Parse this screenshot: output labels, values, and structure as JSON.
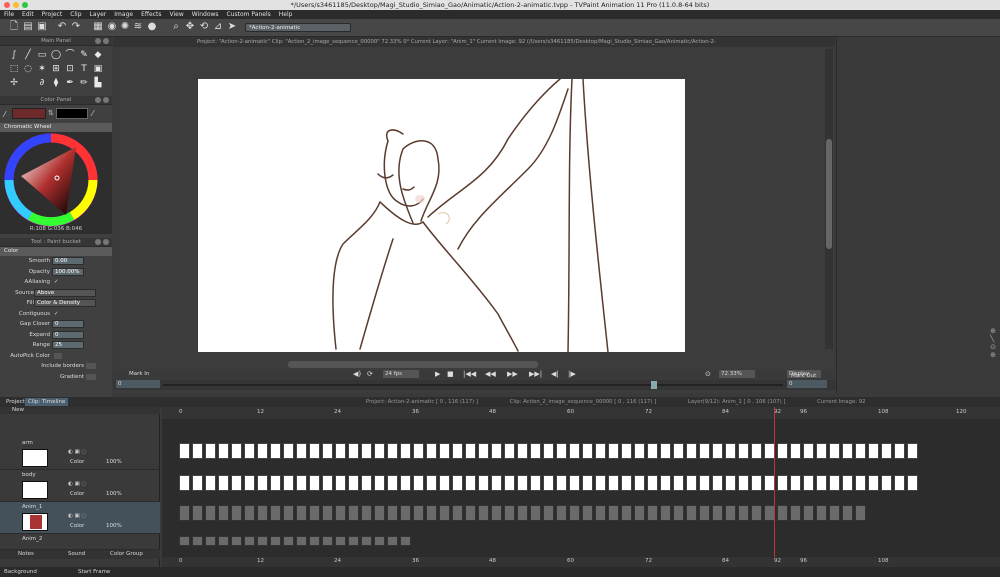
{
  "window": {
    "title": "*/Users/s3461185/Desktop/Magi_Studio_Simiao_Gao/Animatic/Action-2-animatic.tvpp - TVPaint Animation 11 Pro (11.0.8-64 bits)"
  },
  "menu": [
    "File",
    "Edit",
    "Project",
    "Clip",
    "Layer",
    "Image",
    "Effects",
    "View",
    "Windows",
    "Custom Panels",
    "Help"
  ],
  "toolbar": {
    "project_field": "*Action-2-animatic"
  },
  "main_panel": {
    "title": "Main Panel"
  },
  "color_panel": {
    "title": "Color Panel",
    "primary_color": "#6e2a2a",
    "secondary_color": "#000000",
    "wheel_label": "Chromatic Wheel",
    "rgb_readout": "R:108 G:036 B:046"
  },
  "tool_panel": {
    "title": "Tool : Paint bucket",
    "section": "Color",
    "smooth_label": "Smooth",
    "smooth_value": "0.00",
    "opacity_label": "Opacity",
    "opacity_value": "100.00%",
    "aaliasing_label": "AAliasing",
    "source_label": "Source",
    "source_value": "Above",
    "fill_label": "Fill",
    "fill_value": "Color & Density",
    "contiguous_label": "Contiguous",
    "gapcloser_label": "Gap Closer",
    "gapcloser_value": "0",
    "expand_label": "Expand",
    "expand_value": "0",
    "range_label": "Range",
    "range_value": "25",
    "autopick_label": "AutoPick Color",
    "include_borders_label": "Include borders",
    "gradient_label": "Gradient"
  },
  "viewport": {
    "header": "Project: \"Action-2-animatic\"  Clip: \"Action_2_image_sequence_00000\"  72.33%  0°  Current Layer: \"Anim_1\"  Current Image: 92 (/Users/s3461185/Desktop/Magi_Studio_Simiao_Gao/Animatic/Action-2-",
    "mark_in": "Mark In",
    "mark_out": "Mark Out",
    "fps": "24 fps",
    "zoom": "72.33%",
    "display": "Display",
    "in_value": "0",
    "out_value": "0"
  },
  "timeline": {
    "tab_project": "Project",
    "tab_clip": "Clip: Timeline",
    "info_project": "Project: Action-2-animatic [ 0 , 116 (117) ]",
    "info_clip": "Clip: Action_2_image_sequence_00000 [ 0 , 116 (117) ]",
    "info_layer": "Layer(9/12): Anim_1 [ 0 , 106 (107) ]",
    "info_image": "Current Image: 92",
    "ruler_ticks": [
      "0",
      "12",
      "24",
      "36",
      "48",
      "60",
      "72",
      "84",
      "92",
      "96",
      "108",
      "120"
    ],
    "bottom_ticks": [
      "0",
      "12",
      "24",
      "36",
      "48",
      "60",
      "72",
      "84",
      "92",
      "96",
      "108"
    ],
    "layers": [
      {
        "name": "New",
        "mode": "",
        "opacity": ""
      },
      {
        "name": "arm",
        "mode": "Color",
        "opacity": "100%"
      },
      {
        "name": "body",
        "mode": "Color",
        "opacity": "100%"
      },
      {
        "name": "Anim_1",
        "mode": "Color",
        "opacity": "100%"
      },
      {
        "name": "Anim_2",
        "mode": "",
        "opacity": ""
      }
    ],
    "notes_label": "Notes",
    "sound_label": "Sound",
    "color_group_label": "Color Group",
    "background_label": "Background",
    "start_frame_label": "Start Frame"
  }
}
